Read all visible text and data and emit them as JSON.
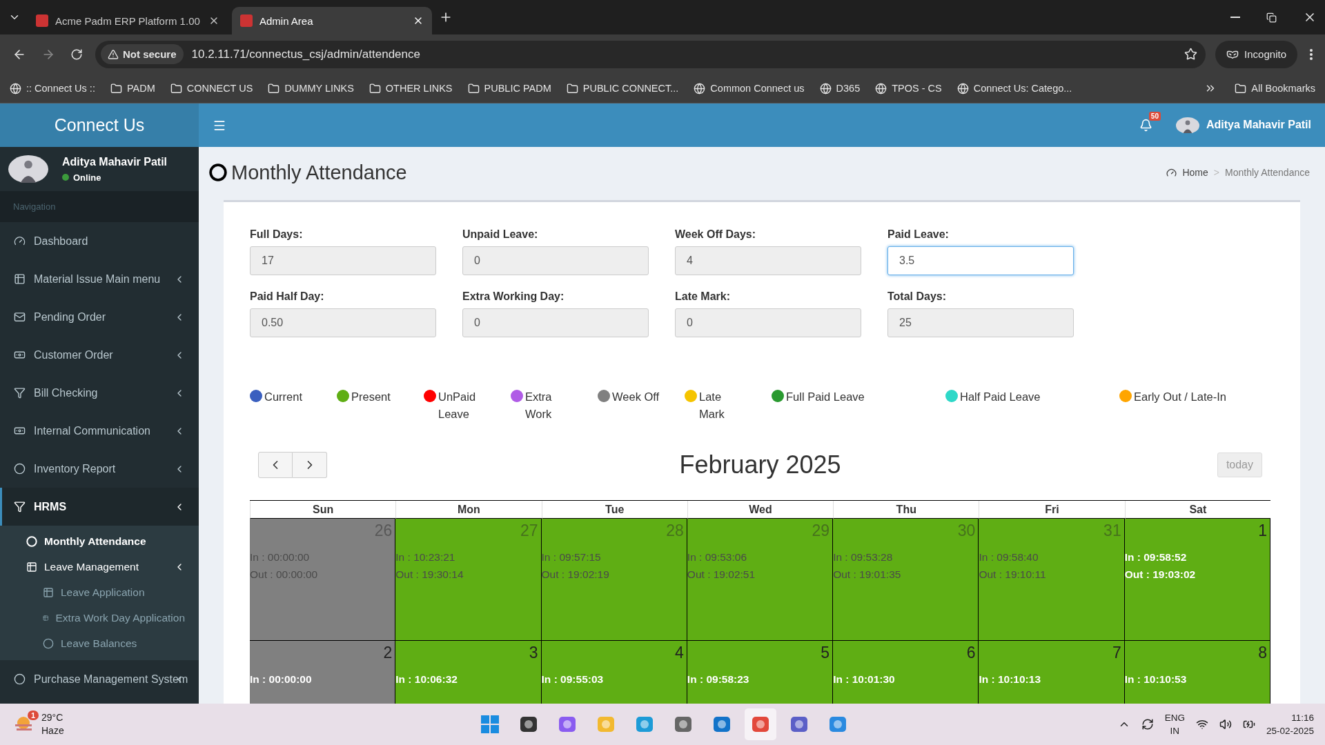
{
  "browser": {
    "tabs": [
      {
        "title": "Acme Padm ERP Platform 1.00",
        "selected": false
      },
      {
        "title": "Admin Area",
        "selected": true
      }
    ],
    "security": "Not secure",
    "url": "10.2.11.71/connectus_csj/admin/attendence",
    "profile": "Incognito",
    "bookmarks": [
      {
        "label": ":: Connect Us ::",
        "kind": "site"
      },
      {
        "label": "PADM",
        "kind": "folder"
      },
      {
        "label": "CONNECT US",
        "kind": "folder"
      },
      {
        "label": "DUMMY LINKS",
        "kind": "folder"
      },
      {
        "label": "OTHER LINKS",
        "kind": "folder"
      },
      {
        "label": "PUBLIC PADM",
        "kind": "folder"
      },
      {
        "label": "PUBLIC CONNECT...",
        "kind": "folder"
      },
      {
        "label": "Common Connect us",
        "kind": "site"
      },
      {
        "label": "D365",
        "kind": "site"
      },
      {
        "label": "TPOS - CS",
        "kind": "site"
      },
      {
        "label": "Connect Us: Catego...",
        "kind": "site"
      }
    ],
    "all_bookmarks": "All Bookmarks"
  },
  "header": {
    "brand": "Connect Us",
    "notification_count": "50",
    "user_name": "Aditya Mahavir Patil"
  },
  "sidebar": {
    "user": {
      "name": "Aditya Mahavir Patil",
      "status": "Online"
    },
    "nav_header": "Navigation",
    "items": [
      {
        "label": "Dashboard",
        "selected": false,
        "has_submenu": false
      },
      {
        "label": "Material Issue Main menu",
        "selected": false,
        "has_submenu": true
      },
      {
        "label": "Pending Order",
        "selected": false,
        "has_submenu": true
      },
      {
        "label": "Customer Order",
        "selected": false,
        "has_submenu": true
      },
      {
        "label": "Bill Checking",
        "selected": false,
        "has_submenu": true
      },
      {
        "label": "Internal Communication",
        "selected": false,
        "has_submenu": true
      },
      {
        "label": "Inventory Report",
        "selected": false,
        "has_submenu": true
      },
      {
        "label": "HRMS",
        "selected": true,
        "has_submenu": true,
        "children": [
          {
            "label": "Monthly Attendance",
            "selected": true
          },
          {
            "label": "Leave Management",
            "selected": false,
            "has_submenu": true,
            "children": [
              {
                "label": "Leave Application",
                "selected": false
              },
              {
                "label": "Extra Work Day Application",
                "selected": false
              },
              {
                "label": "Leave Balances",
                "selected": false
              }
            ]
          }
        ]
      },
      {
        "label": "Purchase Management System",
        "selected": false,
        "has_submenu": true
      }
    ]
  },
  "page": {
    "title": "Monthly Attendance",
    "breadcrumb": {
      "home": "Home",
      "separator": ">",
      "current": "Monthly Attendance"
    },
    "fields": [
      {
        "label": "Full Days:",
        "value": "17",
        "focused": false
      },
      {
        "label": "Unpaid Leave:",
        "value": "0",
        "focused": false
      },
      {
        "label": "Week Off Days:",
        "value": "4",
        "focused": false
      },
      {
        "label": "Paid Leave:",
        "value": "3.5",
        "focused": true
      },
      {
        "label": "Paid Half Day:",
        "value": "0.50",
        "focused": false
      },
      {
        "label": "Extra Working Day:",
        "value": "0",
        "focused": false
      },
      {
        "label": "Late Mark:",
        "value": "0",
        "focused": false
      },
      {
        "label": "Total Days:",
        "value": "25",
        "focused": false
      }
    ],
    "legend": [
      {
        "label": "Current",
        "color": "#3a5fbf"
      },
      {
        "label": "Present",
        "color": "#5fae14"
      },
      {
        "label": "UnPaid\nLeave",
        "color": "#ff0000"
      },
      {
        "label": "Extra\nWork",
        "color": "#b05ce6"
      },
      {
        "label": "Week Off",
        "color": "#808080"
      },
      {
        "label": "Late\nMark",
        "color": "#f5c400"
      },
      {
        "label": "Full Paid Leave",
        "color": "#2a9a30"
      },
      {
        "label": "Half Paid Leave",
        "color": "#2ed8c8"
      },
      {
        "label": "Early Out / Late-In",
        "color": "#ffa500"
      }
    ],
    "calendar": {
      "title": "February 2025",
      "today": "today",
      "weekdays": [
        "Sun",
        "Mon",
        "Tue",
        "Wed",
        "Thu",
        "Fri",
        "Sat"
      ],
      "weeks": [
        [
          {
            "day": "26",
            "in": "In : 00:00:00",
            "out": "Out : 00:00:00",
            "kind": "weekoff",
            "other_month": true
          },
          {
            "day": "27",
            "in": "In : 10:23:21",
            "out": "Out : 19:30:14",
            "kind": "present",
            "other_month": true
          },
          {
            "day": "28",
            "in": "In : 09:57:15",
            "out": "Out : 19:02:19",
            "kind": "present",
            "other_month": true
          },
          {
            "day": "29",
            "in": "In : 09:53:06",
            "out": "Out : 19:02:51",
            "kind": "present",
            "other_month": true
          },
          {
            "day": "30",
            "in": "In : 09:53:28",
            "out": "Out : 19:01:35",
            "kind": "present",
            "other_month": true
          },
          {
            "day": "31",
            "in": "In : 09:58:40",
            "out": "Out : 19:10:11",
            "kind": "present",
            "other_month": true
          },
          {
            "day": "1",
            "in": "In : 09:58:52",
            "out": "Out : 19:03:02",
            "kind": "present",
            "other_month": false
          }
        ],
        [
          {
            "day": "2",
            "in": "In : 00:00:00",
            "kind": "weekoff",
            "other_month": false
          },
          {
            "day": "3",
            "in": "In : 10:06:32",
            "kind": "present",
            "other_month": false
          },
          {
            "day": "4",
            "in": "In : 09:55:03",
            "kind": "present",
            "other_month": false
          },
          {
            "day": "5",
            "in": "In : 09:58:23",
            "kind": "present",
            "other_month": false
          },
          {
            "day": "6",
            "in": "In : 10:01:30",
            "kind": "present",
            "other_month": false
          },
          {
            "day": "7",
            "in": "In : 10:10:13",
            "kind": "present",
            "other_month": false
          },
          {
            "day": "8",
            "in": "In : 10:10:53",
            "kind": "present",
            "other_month": false
          }
        ]
      ]
    }
  },
  "taskbar": {
    "weather": {
      "temp": "29°C",
      "condition": "Haze",
      "badge": "1"
    },
    "lang": [
      "ENG",
      "IN"
    ],
    "time": "11:16",
    "date": "25-02-2025"
  }
}
